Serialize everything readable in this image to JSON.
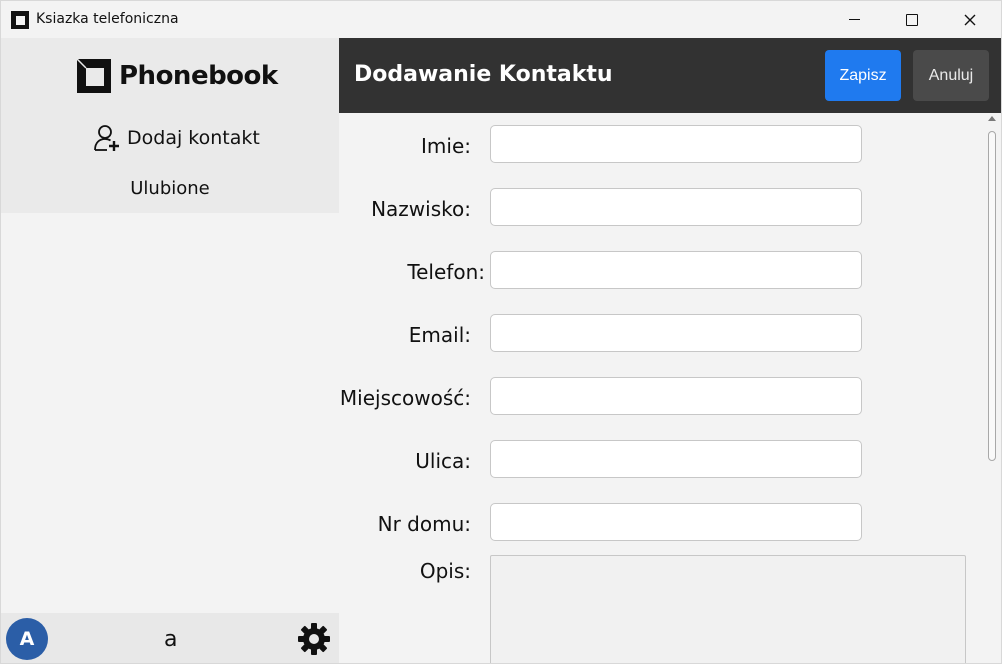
{
  "window": {
    "title": "Ksiazka telefoniczna",
    "minimize_icon": "minimize-icon",
    "maximize_icon": "maximize-icon",
    "close_icon": "close-icon"
  },
  "sidebar": {
    "logo_text": "Phonebook",
    "add_contact_label": "Dodaj kontakt",
    "add_contact_icon": "add-user-icon",
    "favorites_label": "Ulubione",
    "avatar_initial": "A",
    "avatar_color": "#2b5ea7",
    "user_name": "a",
    "settings_icon": "gear-icon"
  },
  "header": {
    "title": "Dodawanie Kontaktu",
    "save_label": "Zapisz",
    "cancel_label": "Anuluj",
    "save_color": "#1f7aef",
    "cancel_color": "#4a4a4a",
    "background": "#323232"
  },
  "form": {
    "fields": [
      {
        "label": "Imie:",
        "value": ""
      },
      {
        "label": "Nazwisko:",
        "value": ""
      },
      {
        "label": "Telefon:",
        "value": ""
      },
      {
        "label": "Email:",
        "value": ""
      },
      {
        "label": "Miejscowość:",
        "value": ""
      },
      {
        "label": "Ulica:",
        "value": ""
      },
      {
        "label": "Nr domu:",
        "value": ""
      }
    ],
    "description_label": "Opis:",
    "description_value": ""
  }
}
